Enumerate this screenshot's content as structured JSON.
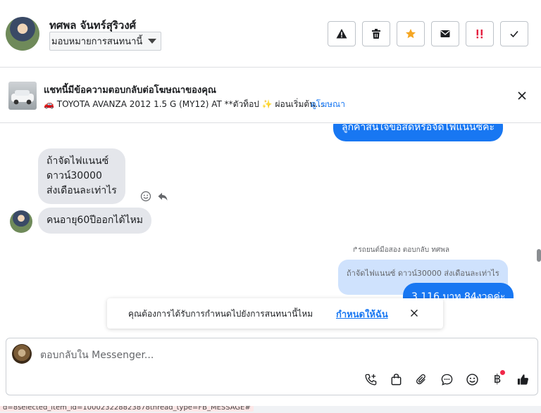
{
  "header": {
    "contact_name": "ทศพล จันทร์สุริวงศ์",
    "assign_label": "มอบหมายการสนทนานี้",
    "actions": [
      {
        "name": "spam-report-button",
        "icon": "warning-icon"
      },
      {
        "name": "delete-button",
        "icon": "trash-icon"
      },
      {
        "name": "star-button",
        "icon": "star-icon"
      },
      {
        "name": "mark-unread-button",
        "icon": "envelope-icon"
      },
      {
        "name": "follow-up-button",
        "icon": "exclamation-icon"
      },
      {
        "name": "mark-done-button",
        "icon": "check-icon"
      }
    ],
    "colors": {
      "star": "#f5a623",
      "follow_up": "#e41e3f"
    }
  },
  "ad": {
    "title": "แชทนี้มีข้อความตอบกลับต่อโฆษณาของคุณ",
    "subtitle": "🚗 TOYOTA AVANZA 2012 1.5 G (MY12) AT **ตัวท็อป ✨ ผ่อนเริ่มต้น...",
    "link": "ดูโฆษณา"
  },
  "conversation": {
    "top_outgoing_partial": "ลูกค้าสนใจขอสดหรือจัดไฟแนนซ์คะ",
    "incoming_1_lines": [
      "ถ้าจัดไฟแนนซ์",
      "ดาวน์30000",
      "ส่งเดือนละเท่าไร"
    ],
    "incoming_2": "คนอายุ60ปีออกได้ไหม",
    "reply_meta": "รถยนต์มือสอง ตอบกลับ ทศพล",
    "quoted_text": "ถ้าจัดไฟแนนซ์ ดาวน์30000 ส่งเดือนละเท่าไร",
    "outgoing_partial": "3,116 บาท 84งวดค่ะ"
  },
  "toast": {
    "text": "คุณต้องการได้รับการกำหนดไปยังการสนทนานี้ไหม",
    "link": "กำหนดให้ฉัน"
  },
  "composer": {
    "placeholder": "ตอบกลับใน Messenger...",
    "tools": [
      "call-add-icon",
      "shopping-bag-icon",
      "paperclip-icon",
      "chat-bubble-icon",
      "emoji-icon",
      "baht-icon",
      "thumbs-up-icon"
    ],
    "baht_symbol": "฿",
    "accent": "#1877f2"
  },
  "url_strip": {
    "text": "d=8selected_item_id=100023228823878thread_type=FB_MESSAGE#"
  }
}
